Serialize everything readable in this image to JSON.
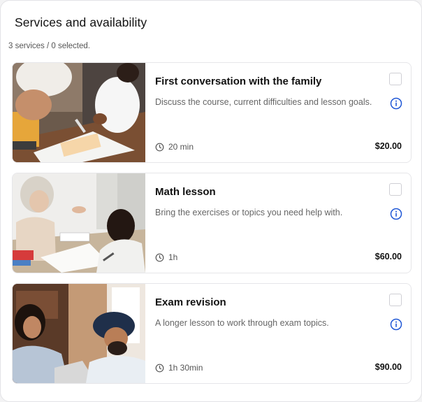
{
  "header": {
    "title": "Services and availability",
    "summary": "3 services / 0 selected."
  },
  "colors": {
    "accent": "#1f57d6",
    "border": "#e6e6e9",
    "muted_text": "#666666"
  },
  "services": [
    {
      "name": "First conversation with the family",
      "description": "Discuss the course, current difficulties and lesson goals.",
      "duration": "20 min",
      "price": "$20.00",
      "selected": false,
      "icons": [
        "clock-icon",
        "info-icon"
      ]
    },
    {
      "name": "Math lesson",
      "description": "Bring the exercises or topics you need help with.",
      "duration": "1h",
      "price": "$60.00",
      "selected": false,
      "icons": [
        "clock-icon",
        "info-icon"
      ]
    },
    {
      "name": "Exam revision",
      "description": "A longer lesson to work through exam topics.",
      "duration": "1h 30min",
      "price": "$90.00",
      "selected": false,
      "icons": [
        "clock-icon",
        "info-icon"
      ]
    }
  ]
}
